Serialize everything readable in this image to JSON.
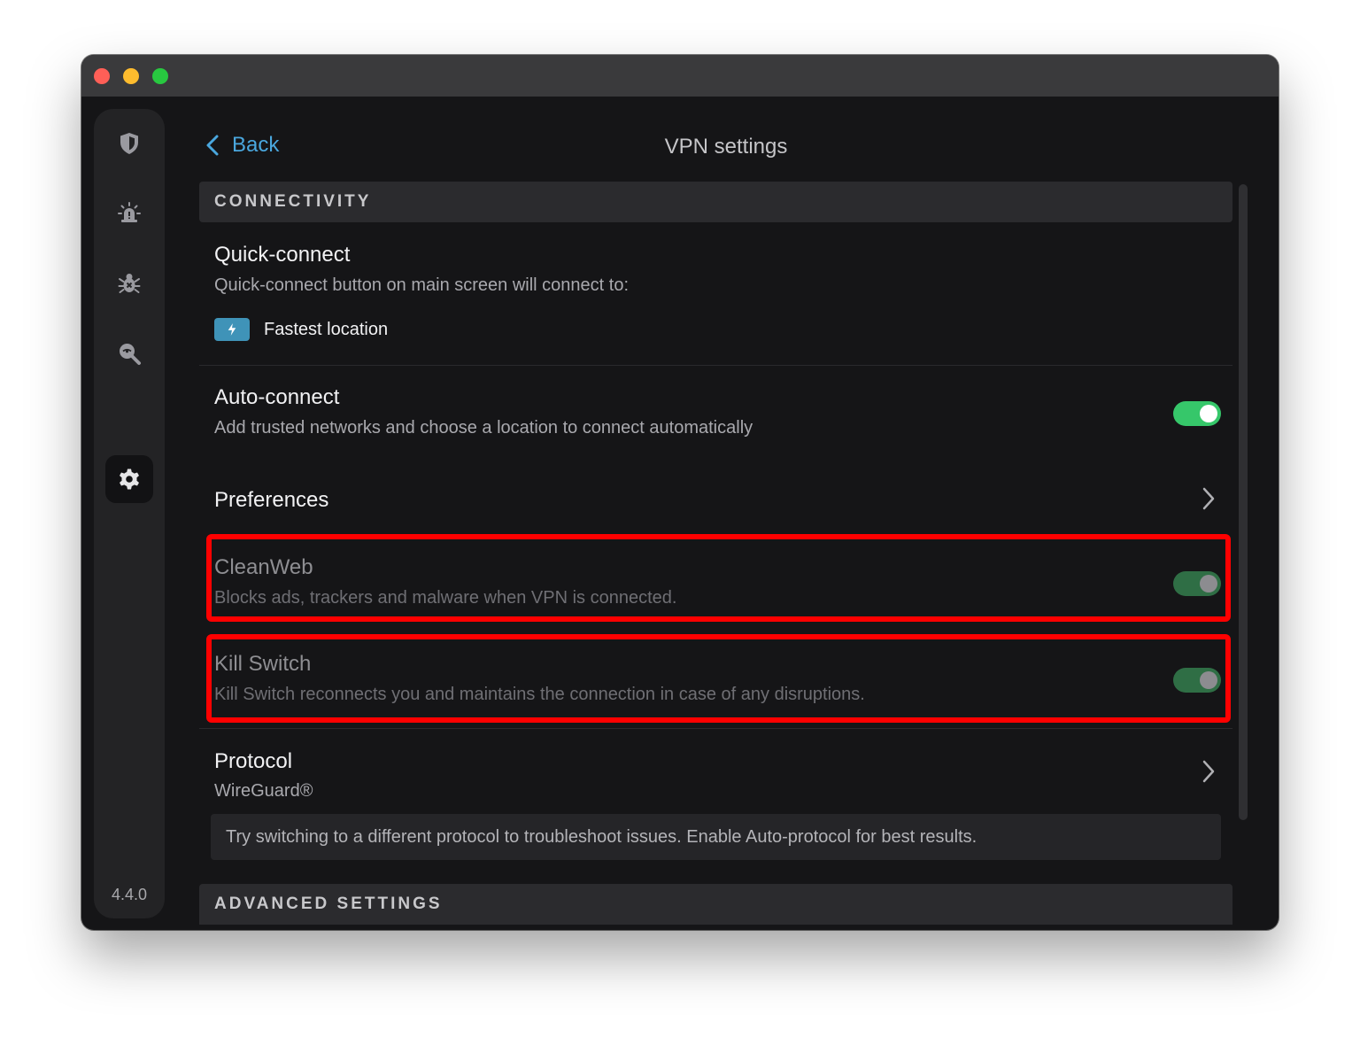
{
  "nav": {
    "back_label": "Back",
    "title": "VPN settings"
  },
  "sidebar": {
    "items": [
      {
        "icon": "shield-icon"
      },
      {
        "icon": "alert-icon"
      },
      {
        "icon": "bug-icon"
      },
      {
        "icon": "search-icon"
      },
      {
        "icon": "gear-icon",
        "active": true
      }
    ],
    "version": "4.4.0"
  },
  "sections": {
    "connectivity": "CONNECTIVITY",
    "advanced": "ADVANCED SETTINGS"
  },
  "quick_connect": {
    "title": "Quick-connect",
    "desc": "Quick-connect button on main screen will connect to:",
    "option": "Fastest location"
  },
  "auto_connect": {
    "title": "Auto-connect",
    "desc": "Add trusted networks and choose a location to connect automatically",
    "enabled": true
  },
  "preferences": {
    "title": "Preferences"
  },
  "cleanweb": {
    "title": "CleanWeb",
    "desc": "Blocks ads, trackers and malware when VPN is connected.",
    "enabled": true
  },
  "kill_switch": {
    "title": "Kill Switch",
    "desc": "Kill Switch reconnects you and maintains the connection in case of any disruptions.",
    "enabled": true
  },
  "protocol": {
    "title": "Protocol",
    "value": "WireGuard®",
    "note": "Try switching to a different protocol to troubleshoot issues. Enable Auto-protocol for best results."
  },
  "colors": {
    "accent_link": "#4aa7de",
    "toggle_on": "#36c76a",
    "toggle_dim": "#2f6e45",
    "highlight": "#ff0000",
    "badge": "#3f93b8"
  }
}
